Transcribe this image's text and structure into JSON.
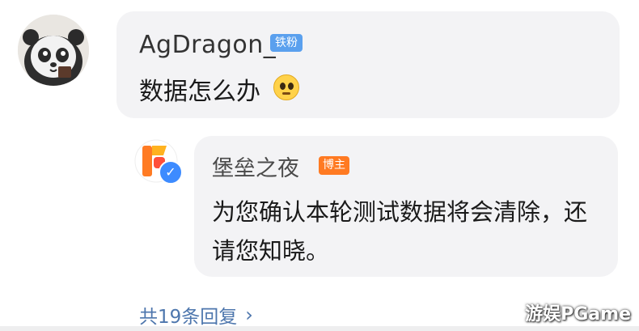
{
  "comment": {
    "username": "AgDragon_",
    "badge": "铁粉",
    "text": "数据怎么办"
  },
  "reply": {
    "author": "堡垒之夜",
    "badge": "博主",
    "text": "为您确认本轮测试数据将会清除，还请您知晓。"
  },
  "footer": {
    "more_replies": "共19条回复",
    "chevron": "›"
  },
  "watermark": "游娱PGame",
  "colors": {
    "bubble": "#f3f3f5",
    "fan_badge": "#5aa0ee",
    "author_badge": "#ff7a22",
    "link": "#4d76ad"
  },
  "icons": {
    "comment_emoji": "pleading-face-icon",
    "verified": "verified-check-icon"
  }
}
